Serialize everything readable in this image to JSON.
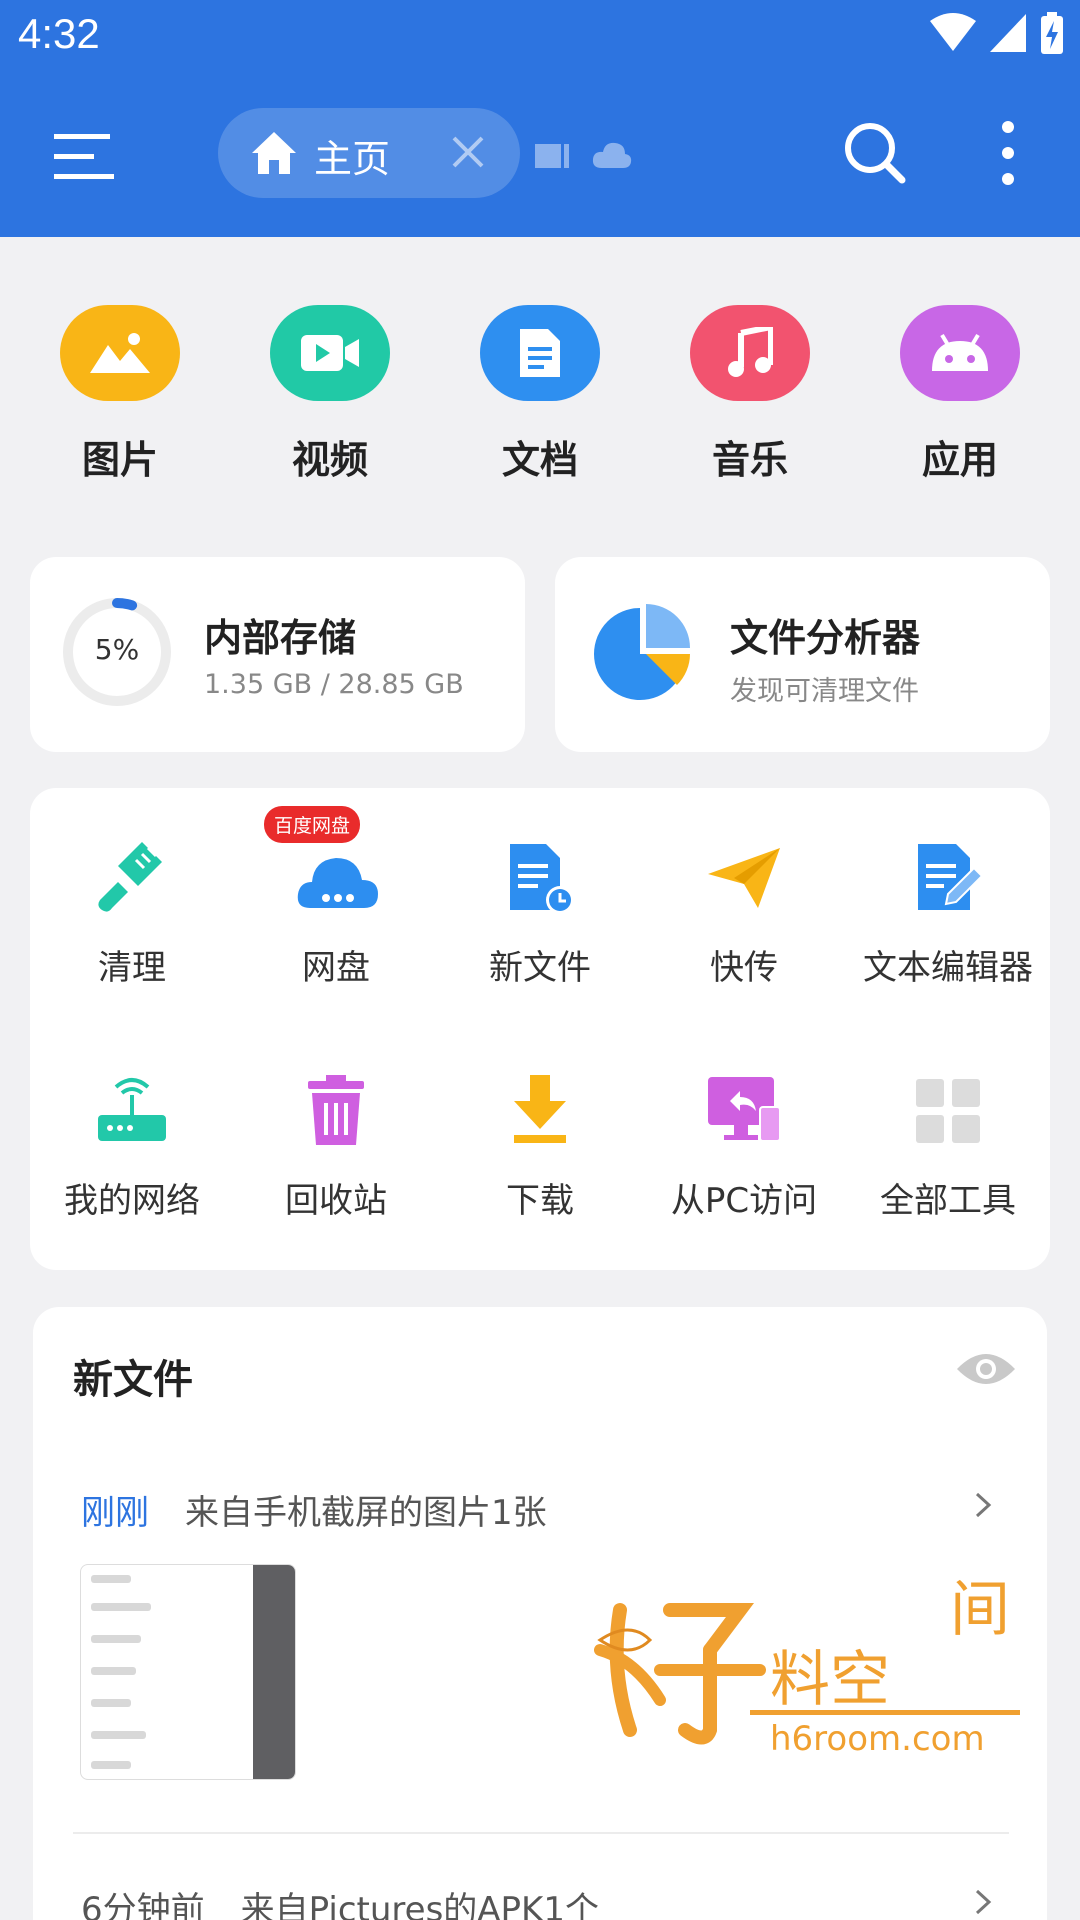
{
  "status": {
    "time": "4:32"
  },
  "appbar": {
    "home_tab_label": "主页"
  },
  "categories": [
    {
      "label": "图片",
      "icon": "picture-icon",
      "color": "#f9b516"
    },
    {
      "label": "视频",
      "icon": "video-icon",
      "color": "#21c9a6"
    },
    {
      "label": "文档",
      "icon": "document-icon",
      "color": "#2e8ff0"
    },
    {
      "label": "音乐",
      "icon": "music-icon",
      "color": "#f2536f"
    },
    {
      "label": "应用",
      "icon": "android-icon",
      "color": "#c867e6"
    }
  ],
  "storage": {
    "percent_label": "5%",
    "percent": 5,
    "title": "内部存储",
    "usage": "1.35 GB / 28.85 GB"
  },
  "analyzer": {
    "title": "文件分析器",
    "subtitle": "发现可清理文件"
  },
  "tools": {
    "badge": "百度网盘",
    "items": [
      {
        "label": "清理",
        "icon": "broom-icon"
      },
      {
        "label": "网盘",
        "icon": "cloud-drive-icon"
      },
      {
        "label": "新文件",
        "icon": "new-file-icon"
      },
      {
        "label": "快传",
        "icon": "paper-plane-icon"
      },
      {
        "label": "文本编辑器",
        "icon": "text-editor-icon"
      },
      {
        "label": "我的网络",
        "icon": "router-icon"
      },
      {
        "label": "回收站",
        "icon": "trash-icon"
      },
      {
        "label": "下载",
        "icon": "download-icon"
      },
      {
        "label": "从PC访问",
        "icon": "pc-access-icon"
      },
      {
        "label": "全部工具",
        "icon": "grid-icon"
      }
    ]
  },
  "new_files": {
    "title": "新文件",
    "entries": [
      {
        "when": "刚刚",
        "desc": "来自手机截屏的图片1张"
      },
      {
        "when": "6分钟前",
        "desc": "来自Pictures的APK1个"
      }
    ]
  },
  "watermark": {
    "logo_text": "好料空间",
    "url": "h6room.com"
  },
  "colors": {
    "primary": "#2d74e0",
    "background": "#f1f1f3"
  }
}
